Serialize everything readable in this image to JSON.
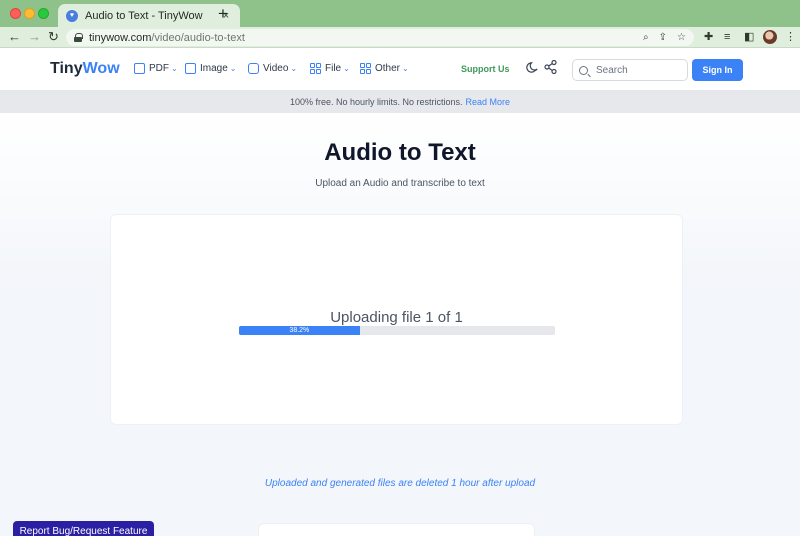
{
  "browser": {
    "tab_title": "Audio to Text - TinyWow",
    "tab_close": "×",
    "new_tab": "+",
    "url_host": "tinywow.com",
    "url_path": "/video/audio-to-text",
    "back": "←",
    "forward": "→",
    "reload": "↻"
  },
  "header": {
    "logo_main": "Tiny",
    "logo_accent": "Wow",
    "menu": [
      {
        "label": "PDF"
      },
      {
        "label": "Image"
      },
      {
        "label": "Video"
      },
      {
        "label": "File"
      },
      {
        "label": "Other"
      }
    ],
    "support": "Support Us",
    "search_placeholder": "Search",
    "signin": "Sign In"
  },
  "banner": {
    "text": "100% free. No hourly limits. No restrictions.",
    "link": "Read More"
  },
  "main": {
    "title": "Audio to Text",
    "subtitle": "Upload an Audio and transcribe to text",
    "upload_status": "Uploading file 1 of 1",
    "progress_percent": 38.2,
    "progress_label": "38.2%",
    "notice": "Uploaded and generated files are deleted 1 hour after upload"
  },
  "footer": {
    "report": "Report Bug/Request Feature"
  },
  "colors": {
    "accent": "#3b82f6",
    "tabbar": "#8fc18a",
    "report": "#2b1fa3"
  }
}
